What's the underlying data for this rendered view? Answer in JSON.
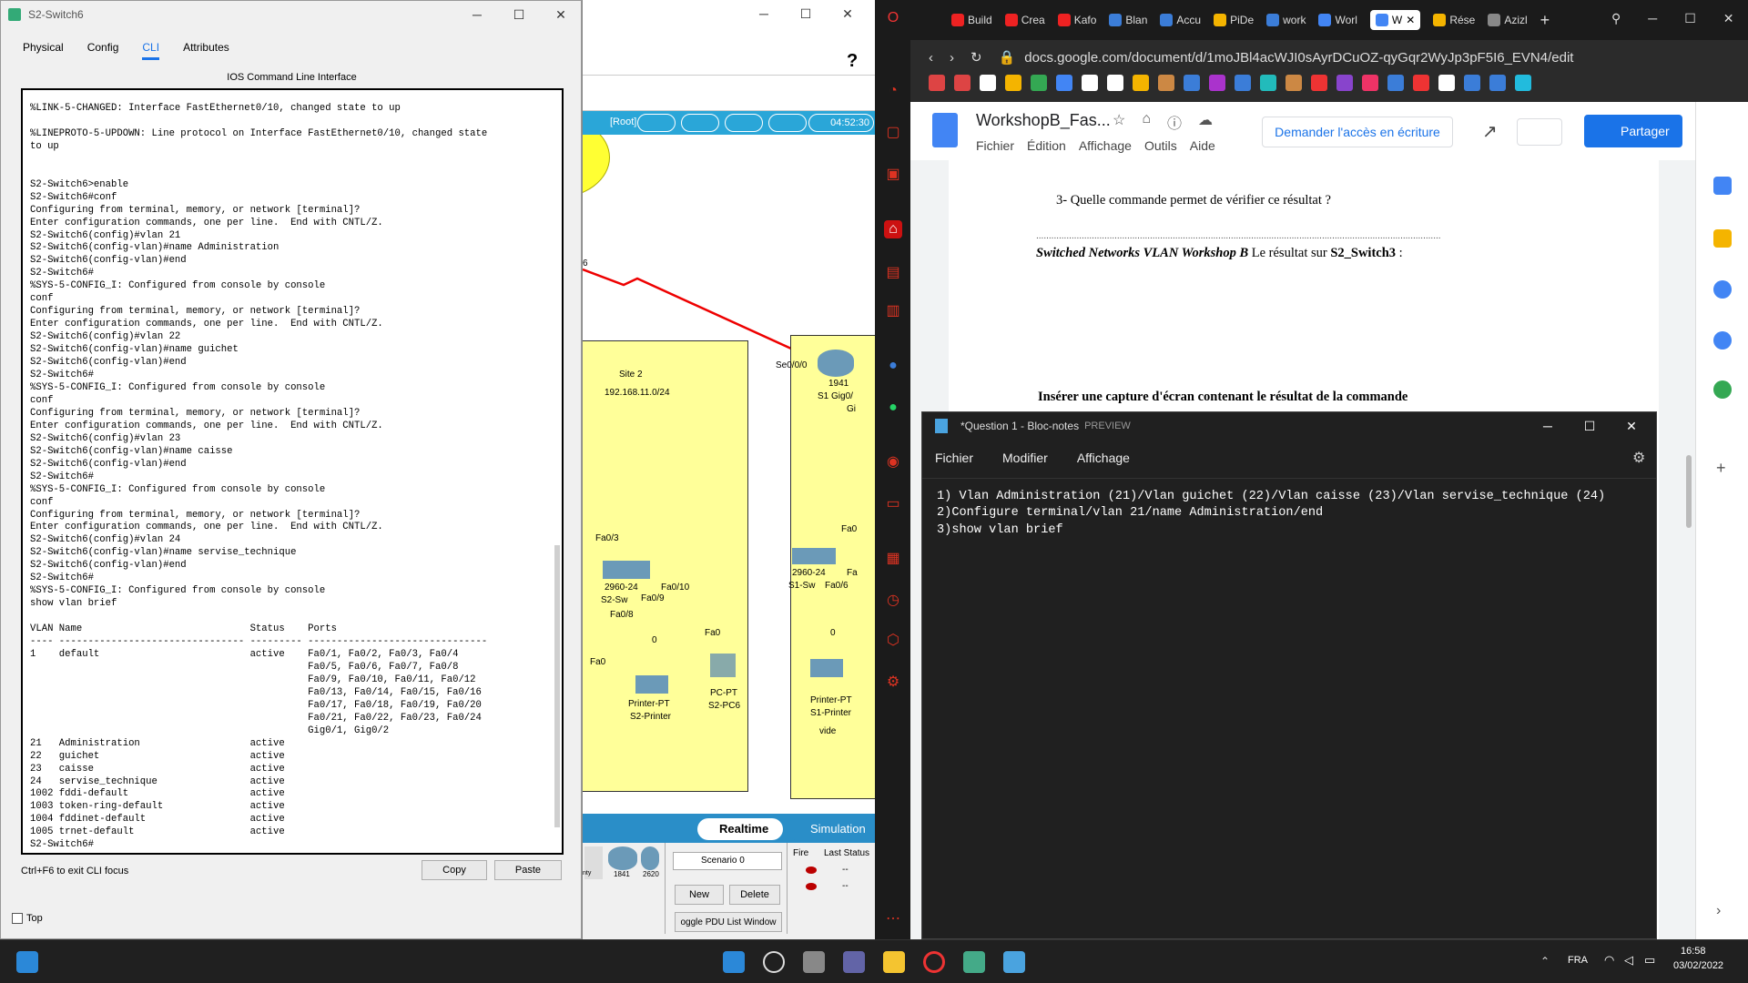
{
  "switch_window": {
    "title": "S2-Switch6",
    "tabs": [
      "Physical",
      "Config",
      "CLI",
      "Attributes"
    ],
    "cli_header": "IOS Command Line Interface",
    "cli_text": "%LINK-5-CHANGED: Interface FastEthernet0/10, changed state to up\n\n%LINEPROTO-5-UPDOWN: Line protocol on Interface FastEthernet0/10, changed state\nto up\n\n\nS2-Switch6>enable\nS2-Switch6#conf\nConfiguring from terminal, memory, or network [terminal]?\nEnter configuration commands, one per line.  End with CNTL/Z.\nS2-Switch6(config)#vlan 21\nS2-Switch6(config-vlan)#name Administration\nS2-Switch6(config-vlan)#end\nS2-Switch6#\n%SYS-5-CONFIG_I: Configured from console by console\nconf\nConfiguring from terminal, memory, or network [terminal]?\nEnter configuration commands, one per line.  End with CNTL/Z.\nS2-Switch6(config)#vlan 22\nS2-Switch6(config-vlan)#name guichet\nS2-Switch6(config-vlan)#end\nS2-Switch6#\n%SYS-5-CONFIG_I: Configured from console by console\nconf\nConfiguring from terminal, memory, or network [terminal]?\nEnter configuration commands, one per line.  End with CNTL/Z.\nS2-Switch6(config)#vlan 23\nS2-Switch6(config-vlan)#name caisse\nS2-Switch6(config-vlan)#end\nS2-Switch6#\n%SYS-5-CONFIG_I: Configured from console by console\nconf\nConfiguring from terminal, memory, or network [terminal]?\nEnter configuration commands, one per line.  End with CNTL/Z.\nS2-Switch6(config)#vlan 24\nS2-Switch6(config-vlan)#name servise_technique\nS2-Switch6(config-vlan)#end\nS2-Switch6#\n%SYS-5-CONFIG_I: Configured from console by console\nshow vlan brief\n\nVLAN Name                             Status    Ports\n---- -------------------------------- --------- -------------------------------\n1    default                          active    Fa0/1, Fa0/2, Fa0/3, Fa0/4\n                                                Fa0/5, Fa0/6, Fa0/7, Fa0/8\n                                                Fa0/9, Fa0/10, Fa0/11, Fa0/12\n                                                Fa0/13, Fa0/14, Fa0/15, Fa0/16\n                                                Fa0/17, Fa0/18, Fa0/19, Fa0/20\n                                                Fa0/21, Fa0/22, Fa0/23, Fa0/24\n                                                Gig0/1, Gig0/2\n21   Administration                   active\n22   guichet                          active\n23   caisse                           active\n24   servise_technique                active\n1002 fddi-default                     active\n1003 token-ring-default               active\n1004 fddinet-default                  active\n1005 trnet-default                    active\nS2-Switch6#",
    "hint": "Ctrl+F6 to exit CLI focus",
    "copy": "Copy",
    "paste": "Paste",
    "top_checkbox": "Top"
  },
  "packet_tracer": {
    "root": "[Root]",
    "time": "04:52:30",
    "site_label": "Site 2",
    "subnet": "192.168.11.0/24",
    "link_label_6": "6",
    "router_port": "Se0/0/0",
    "router_model": "1941",
    "router_name": "S1 Gig0/",
    "router_gi": "Gi",
    "fa03": "Fa0/3",
    "fa010": "Fa0/10",
    "fa08": "Fa0/8",
    "fa09": "Fa0/9",
    "fa0": "Fa0",
    "fa0b": "Fa0",
    "fa0c": "Fa0",
    "zero": "0",
    "zero2": "0",
    "s2_switch_model": "2960-24",
    "s2_switch_name": "S2-Sw",
    "s1_switch_model": "2960-24",
    "s1_switch_name": "S1-Sw",
    "fa0_s1": "Fa0/6",
    "fa_right": "Fa",
    "fa0_top": "Fa0",
    "six": "6",
    "printer2_type": "Printer-PT",
    "printer2_name": "S2-Printer",
    "pc_type": "PC-PT",
    "pc_name": "S2-PC6",
    "printer1_type": "Printer-PT",
    "printer1_name": "S1-Printer",
    "vide": "vide",
    "realtime": "Realtime",
    "simulation": "Simulation",
    "scenario": "Scenario 0",
    "new": "New",
    "delete": "Delete",
    "toggle_pdu": "oggle PDU List Window",
    "fire": "Fire",
    "last_status": "Last Status",
    "dash": "--",
    "dev1": "1841",
    "dev2": "2620",
    "dev3": "nty"
  },
  "browser": {
    "tabs": [
      {
        "label": "Build",
        "color": "#e22"
      },
      {
        "label": "Crea",
        "color": "#e22"
      },
      {
        "label": "Kafo",
        "color": "#e22"
      },
      {
        "label": "Blan",
        "color": "#3b7dd8"
      },
      {
        "label": "Accu",
        "color": "#3b7dd8"
      },
      {
        "label": "PiDe",
        "color": "#f4b400"
      },
      {
        "label": "work",
        "color": "#3b7dd8"
      },
      {
        "label": "Worl",
        "color": "#4285f4"
      },
      {
        "label": "W",
        "color": "#4285f4"
      },
      {
        "label": "Rése",
        "color": "#f4b400"
      },
      {
        "label": "Azizl",
        "color": "#888"
      }
    ],
    "url": "docs.google.com/document/d/1moJBl4acWJI0sAyrDCuOZ-qyGqr2WyJp3pF5I6_EVN4/edit",
    "doc_title": "WorkshopB_Fas...",
    "menus": [
      "Fichier",
      "Édition",
      "Affichage",
      "Outils",
      "Aide"
    ],
    "request_access": "Demander l'accès en écriture",
    "share": "Partager",
    "q3": "3- Quelle commande permet de vérifier ce résultat ?",
    "dotted": "................................................................................................................................................................",
    "result_italic": "Switched Networks VLAN Workshop B",
    "result_rest": "  Le résultat sur ",
    "result_bold": "S2_Switch3",
    "result_colon": " :",
    "insert": "Insérer une capture d'écran contenant le résultat de la commande"
  },
  "notepad": {
    "title": "*Question 1 - Bloc-notes",
    "preview": "PREVIEW",
    "menus": [
      "Fichier",
      "Modifier",
      "Affichage"
    ],
    "content": "1) Vlan Administration (21)/Vlan guichet (22)/Vlan caisse (23)/Vlan servise_technique (24)\n2)Configure terminal/vlan 21/name Administration/end\n3)show vlan brief"
  },
  "taskbar": {
    "lang": "FRA",
    "time": "16:58",
    "date": "03/02/2022"
  }
}
